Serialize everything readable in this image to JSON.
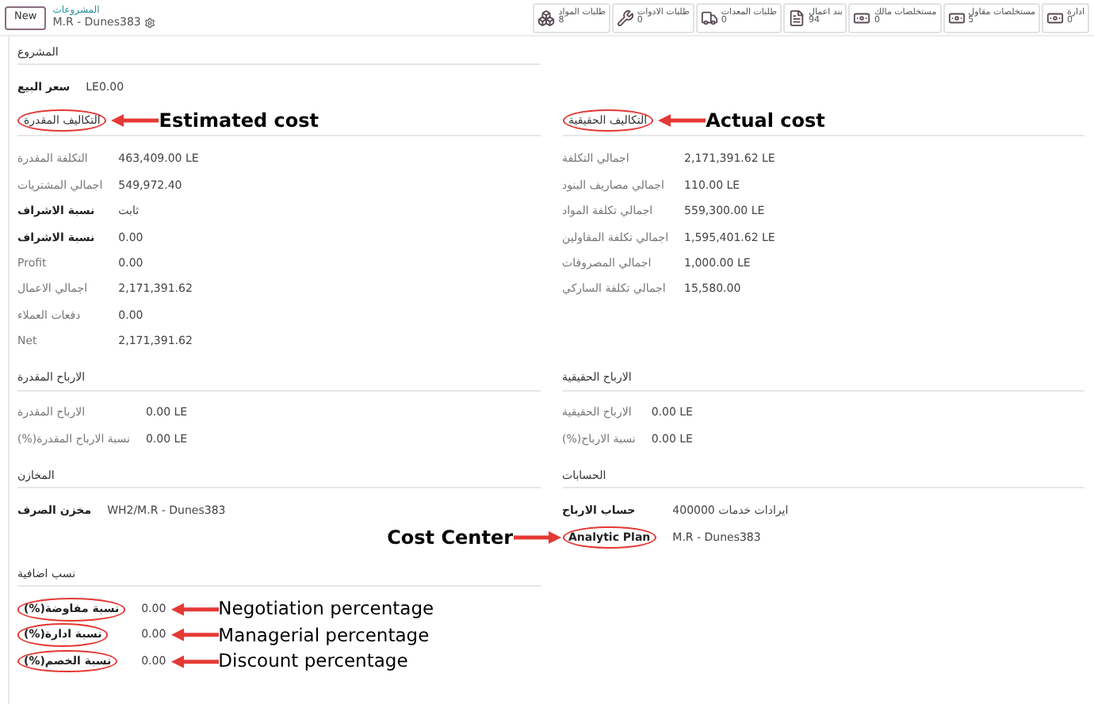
{
  "header": {
    "new_button": "New",
    "breadcrumb": "المشروعات",
    "record": "M.R - Dunes383"
  },
  "smart_buttons": [
    {
      "kind": "money",
      "label": "ادارة",
      "count": "0"
    },
    {
      "kind": "money",
      "label": "مستخلصات مقاول",
      "count": "5"
    },
    {
      "kind": "money",
      "label": "مستخلصات مالك",
      "count": "0"
    },
    {
      "kind": "document",
      "label": "بند اعمال",
      "count": "94"
    },
    {
      "kind": "truck",
      "label": "طلبات المعدات",
      "count": "0"
    },
    {
      "kind": "wrench",
      "label": "طلبات الادوات",
      "count": "0"
    },
    {
      "kind": "boxes",
      "label": "طلبات المواد",
      "count": "8"
    }
  ],
  "section_rows": [
    {
      "sections": [
        {
          "heading": "المشروع",
          "fields": [
            {
              "label": "سعر البيع",
              "value": "LE0.00",
              "bold": true
            }
          ]
        }
      ]
    },
    {
      "sections": [
        {
          "heading": "التكاليف الحقيقية",
          "annotation": {
            "text": "Actual cost",
            "kind": "trailing",
            "bold": true
          },
          "fields": [
            {
              "label": "اجمالي التكلفة",
              "value": "2,171,391.62 LE",
              "bold": false
            },
            {
              "label": "اجمالي مصاريف البنود",
              "value": "110.00 LE",
              "bold": false
            },
            {
              "label": "اجمالي تكلفة المواد",
              "value": "559,300.00 LE",
              "bold": false
            },
            {
              "label": "اجمالي تكلفة المقاولين",
              "value": "1,595,401.62 LE",
              "bold": false
            },
            {
              "label": "اجمالي المصروفات",
              "value": "1,000.00 LE",
              "bold": false
            },
            {
              "label": "اجمالي تكلفة الساركي",
              "value": "15,580.00",
              "bold": false
            }
          ]
        },
        {
          "heading": "التكاليف المقدرة",
          "annotation": {
            "text": "Estimated cost",
            "kind": "trailing",
            "bold": true
          },
          "fields": [
            {
              "label": "التكلفة المقدرة",
              "value": "463,409.00 LE",
              "bold": false
            },
            {
              "label": "اجمالي المشتريات",
              "value": "549,972.40",
              "bold": false
            },
            {
              "label": "نسبة الاشراف",
              "value": "ثابت",
              "bold": true
            },
            {
              "label": "نسبة الاشراف",
              "value": "0.00",
              "bold": true
            },
            {
              "label": "Profit",
              "value": "0.00",
              "bold": false
            },
            {
              "label": "اجمالي الاعمال",
              "value": "2,171,391.62",
              "bold": false
            },
            {
              "label": "دفعات العملاء",
              "value": "0.00",
              "bold": false
            },
            {
              "label": "Net",
              "value": "2,171,391.62",
              "bold": false
            }
          ]
        }
      ]
    },
    {
      "sections": [
        {
          "heading": "الارباح الحقيقية",
          "fields": [
            {
              "label": "الارباح الحقيقية",
              "value": "0.00 LE",
              "bold": false
            },
            {
              "label": "(%)نسبة الارباح",
              "value": "0.00 LE",
              "bold": false
            }
          ]
        },
        {
          "heading": "الارباح المقدرة",
          "fields": [
            {
              "label": "الارباح المقدرة",
              "value": "0.00 LE",
              "bold": false
            },
            {
              "label": "(%)نسبة الارباح المقدرة",
              "value": "0.00 LE",
              "bold": false
            }
          ]
        }
      ]
    },
    {
      "sections": [
        {
          "heading": "الحسابات",
          "fields": [
            {
              "label": "حساب الارباح",
              "value": "400000 ايرادات خدمات",
              "bold": true
            },
            {
              "label": "Analytic Plan",
              "value": "M.R - Dunes383",
              "bold": true,
              "annotation": {
                "text": "Cost Center",
                "kind": "leading",
                "bold": true
              }
            }
          ]
        },
        {
          "heading": "المخازن",
          "fields": [
            {
              "label": "مخزن الصرف",
              "value": "WH2/M.R - Dunes383",
              "bold": true
            }
          ]
        }
      ]
    },
    {
      "sections": [
        {
          "heading": "نسب اضافية",
          "fields": [
            {
              "label": "(%)نسبة مفاوضة",
              "value": "0.00",
              "bold": true,
              "annotation": {
                "text": "Negotiation percentage",
                "kind": "trailing",
                "bold": false
              }
            },
            {
              "label": "(%)نسبة ادارة",
              "value": "0.00",
              "bold": true,
              "annotation": {
                "text": "Managerial  percentage",
                "kind": "trailing",
                "bold": false
              }
            },
            {
              "label": "(%)نسبة الخصم",
              "value": "0.00",
              "bold": true,
              "annotation": {
                "text": "Discount  percentage",
                "kind": "trailing",
                "bold": false
              }
            }
          ]
        }
      ]
    }
  ]
}
